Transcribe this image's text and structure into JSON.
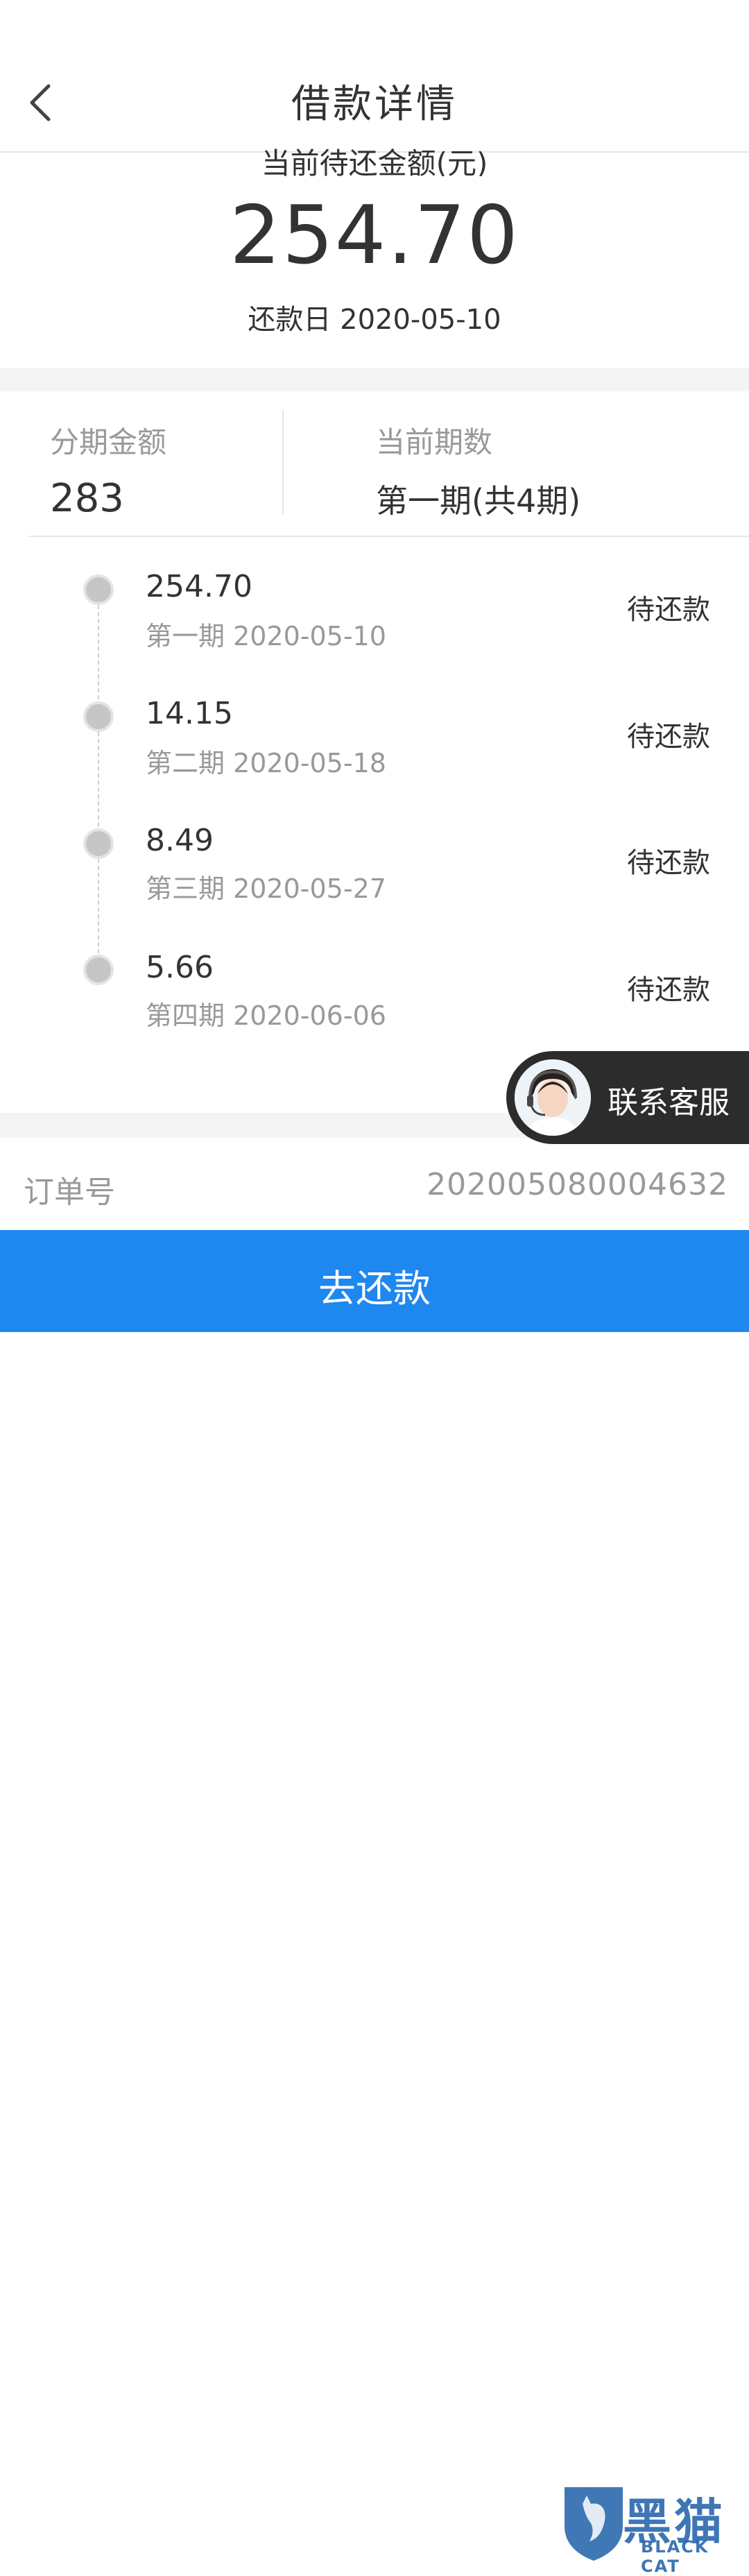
{
  "header": {
    "title": "借款详情"
  },
  "summary": {
    "label": "当前待还金额(元)",
    "amount": "254.70",
    "due": "还款日 2020-05-10"
  },
  "info": {
    "installment_label": "分期金额",
    "installment_value": "283",
    "period_label": "当前期数",
    "period_value": "第一期(共4期)"
  },
  "schedule": [
    {
      "amount": "254.70",
      "sub": "第一期 2020-05-10",
      "status": "待还款"
    },
    {
      "amount": "14.15",
      "sub": "第二期 2020-05-18",
      "status": "待还款"
    },
    {
      "amount": "8.49",
      "sub": "第三期 2020-05-27",
      "status": "待还款"
    },
    {
      "amount": "5.66",
      "sub": "第四期 2020-06-06",
      "status": "待还款"
    }
  ],
  "service": {
    "label": "联系客服"
  },
  "order": {
    "label": "订单号",
    "number": "202005080004632"
  },
  "action": {
    "pay_label": "去还款"
  },
  "watermark": {
    "main": "黑猫",
    "sub": "BLACK CAT"
  },
  "colors": {
    "primary": "#1e87f0",
    "service_bg": "#2c2c2c",
    "gap": "#f4f4f4"
  }
}
